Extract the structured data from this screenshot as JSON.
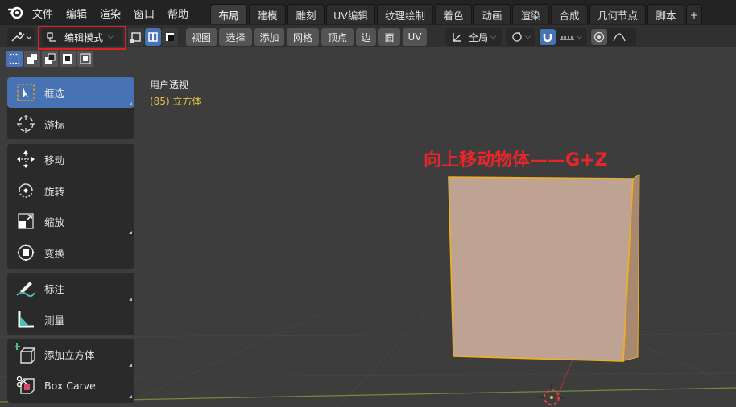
{
  "menu": {
    "items": [
      "文件",
      "编辑",
      "渲染",
      "窗口",
      "帮助"
    ]
  },
  "workspace_tabs": [
    "布局",
    "建模",
    "雕刻",
    "UV编辑",
    "纹理绘制",
    "着色",
    "动画",
    "渲染",
    "合成",
    "几何节点",
    "脚本",
    "+"
  ],
  "active_tab": "布局",
  "header": {
    "mode": "编辑模式",
    "menus": [
      "视图",
      "选择",
      "添加",
      "网格",
      "顶点",
      "边",
      "面",
      "UV"
    ],
    "transform_orientation": "全局"
  },
  "toolbar": {
    "groups": [
      [
        {
          "label": "框选",
          "icon": "box-select-icon",
          "active": true
        },
        {
          "label": "游标",
          "icon": "cursor-icon"
        }
      ],
      [
        {
          "label": "移动",
          "icon": "move-icon"
        },
        {
          "label": "旋转",
          "icon": "rotate-icon"
        },
        {
          "label": "缩放",
          "icon": "scale-icon"
        },
        {
          "label": "变换",
          "icon": "transform-icon"
        }
      ],
      [
        {
          "label": "标注",
          "icon": "annotate-icon"
        },
        {
          "label": "测量",
          "icon": "measure-icon"
        }
      ],
      [
        {
          "label": "添加立方体",
          "icon": "add-cube-icon"
        },
        {
          "label": "Box Carve",
          "icon": "box-carve-icon"
        }
      ]
    ]
  },
  "viewport": {
    "view_name": "用户透视",
    "object_info": "(85) 立方体",
    "annotation": "向上移动物体——G+Z"
  },
  "colors": {
    "accent": "#4772b3",
    "highlight_box": "#e02020",
    "annotation": "#e8262a",
    "object_info": "#e3c04a",
    "cube": "#bfa392",
    "cube_edge": "#f0b020"
  }
}
